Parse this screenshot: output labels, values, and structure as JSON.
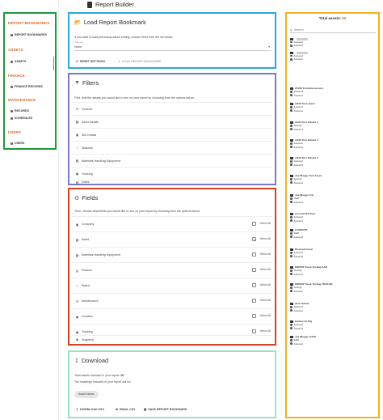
{
  "header": {
    "title": "Report Builder"
  },
  "sidebar": {
    "sections": [
      {
        "title": "REPORT BOOKMARKS",
        "items": [
          "REPORT BOOKMARKS"
        ]
      },
      {
        "title": "ASSETS",
        "items": [
          "ASSETS"
        ]
      },
      {
        "title": "FINANCE",
        "items": [
          "FINANCE RECORDS"
        ]
      },
      {
        "title": "MAINTENANCE",
        "items": [
          "RECORDS",
          "SCHEDULES"
        ]
      },
      {
        "title": "USERS",
        "items": [
          "USERS"
        ]
      }
    ]
  },
  "bookmark": {
    "title": "Load Report Bookmark",
    "intro": "If you want to load previously saved setting, choose them from the list below:",
    "select_label": "Settings",
    "select_value": "None",
    "reset_label": "RESET SETTINGS",
    "load_label": "LOAD REPORT BOOKMARK"
  },
  "filters": {
    "title": "Filters",
    "intro": "First, limit the assets you would like to see on your report by choosing from the options below:",
    "items": [
      "General",
      "Asset Details",
      "Site Details",
      "Statuses",
      "Materials Handling Equipment",
      "Tracking",
      "Dates"
    ]
  },
  "fields": {
    "title": "Fields",
    "intro": "Then, choose what fields you would like to see on your report by choosing from the options below:",
    "select_all_label": "Select All",
    "items": [
      "Company",
      "Asset",
      "Materials Handling Equipment",
      "Finance",
      "Status",
      "Maintenance",
      "Location",
      "Tracking",
      "Snapshot"
    ]
  },
  "download": {
    "title": "Download",
    "total_label": "Total assets included in your report:",
    "total_value": "50",
    "headings_text": "The headings included in your report will be:",
    "chip": "Asset Name",
    "csv_label": "DOWNLOAD CSV",
    "email_label": "EMAIL CSV",
    "save_label": "SAVE REPORT BOOKMARK"
  },
  "assets": {
    "title": "Total assets:",
    "count": "50",
    "search_placeholder": "Search",
    "items": [
      {
        "name": "",
        "sub1": "Assured",
        "sub2": "Assured"
      },
      {
        "name": "",
        "sub1": "Assured",
        "sub2": "Assured"
      },
      {
        "name": "AT202 Commission test",
        "sub1": "Assured",
        "sub2": "Assured"
      },
      {
        "name": "AX20 First-Aurot",
        "sub1": "Assured",
        "sub2": "Assured"
      },
      {
        "name": "AX26 Test Vehicle 1",
        "sub1": "Testing",
        "sub2": "Assured"
      },
      {
        "name": "AX26 Test Vehicle 4",
        "sub1": "Assured",
        "sub2": "Assured"
      },
      {
        "name": "AX26 Test Vehicle 5",
        "sub1": "Assured",
        "sub2": "Assured"
      },
      {
        "name": "Joe Bloggs Test Asset",
        "sub1": "Testing",
        "sub2": "Assured"
      },
      {
        "name": "Joe Bloggs' Car",
        "sub1": "Staff",
        "sub2": "Assured"
      },
      {
        "name": "Account BT Door",
        "sub1": "Assured",
        "sub2": "Assured"
      },
      {
        "name": "CAR10245",
        "sub1": "Staff",
        "sub2": "Assured"
      },
      {
        "name": "Disposal Asset",
        "sub1": "Assured",
        "sub2": "Assured"
      },
      {
        "name": "DSP900 Truck Testing CAR",
        "sub1": "Testing",
        "sub2": "Assured"
      },
      {
        "name": "DSP900 Truck Testing TRAILER",
        "sub1": "Testing",
        "sub2": "Assured"
      },
      {
        "name": "Test Vehicle",
        "sub1": "Assured",
        "sub2": "Assured"
      },
      {
        "name": "Holden HL Rig",
        "sub1": "Assured",
        "sub2": "Assured"
      },
      {
        "name": "Joe Bloggs' AX26",
        "sub1": "Staff",
        "sub2": "Assured"
      }
    ]
  }
}
